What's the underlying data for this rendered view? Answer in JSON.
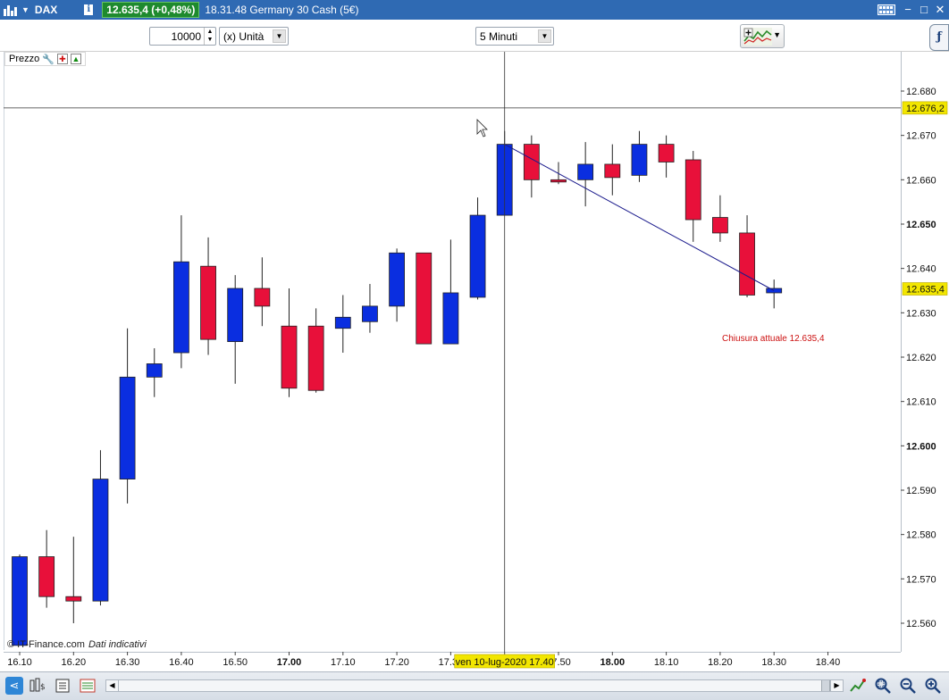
{
  "titlebar": {
    "symbol": "DAX",
    "info": "i",
    "price_badge": "12.635,4 (+0,48%)",
    "description": "18.31.48 Germany 30 Cash (5€)"
  },
  "toolbar": {
    "quantity": "10000",
    "unit": "(x) Unità",
    "timeframe": "5 Minuti"
  },
  "panel": {
    "label": "Prezzo"
  },
  "watermark": {
    "brand": "© IT-Finance.com",
    "note": "Dati indicativi"
  },
  "colors": {
    "up": "#0a2ee0",
    "down": "#e8103a",
    "trendline": "#1a1a8c",
    "badge": "#f2e600",
    "annotation": "#cc1111"
  },
  "chart_data": {
    "type": "candlestick",
    "y_ticks": [
      "12.680",
      "12.670",
      "12.660",
      "12.650",
      "12.640",
      "12.630",
      "12.620",
      "12.610",
      "12.600",
      "12.590",
      "12.580",
      "12.570",
      "12.560"
    ],
    "y_ticks_bold": [
      "12.650",
      "12.600"
    ],
    "ylim": [
      12555,
      12692
    ],
    "x_ticks": [
      {
        "label": "16.10",
        "bold": false
      },
      {
        "label": "16.20",
        "bold": false
      },
      {
        "label": "16.30",
        "bold": false
      },
      {
        "label": "16.40",
        "bold": false
      },
      {
        "label": "16.50",
        "bold": false
      },
      {
        "label": "17.00",
        "bold": true
      },
      {
        "label": "17.10",
        "bold": false
      },
      {
        "label": "17.20",
        "bold": false
      },
      {
        "label": "17.30",
        "bold": false
      },
      {
        "label": "17.40",
        "bold": false
      },
      {
        "label": "17.50",
        "bold": false
      },
      {
        "label": "18.00",
        "bold": true
      },
      {
        "label": "18.10",
        "bold": false
      },
      {
        "label": "18.20",
        "bold": false
      },
      {
        "label": "18.30",
        "bold": false
      },
      {
        "label": "18.40",
        "bold": false
      }
    ],
    "candles": [
      {
        "t": "16.10",
        "o": 12555,
        "h": 12575.5,
        "l": 12555,
        "c": 12575
      },
      {
        "t": "16.15",
        "o": 12575,
        "h": 12581,
        "l": 12563.5,
        "c": 12566
      },
      {
        "t": "16.20",
        "o": 12566,
        "h": 12579.5,
        "l": 12560,
        "c": 12565
      },
      {
        "t": "16.25",
        "o": 12565,
        "h": 12599,
        "l": 12564,
        "c": 12592.5
      },
      {
        "t": "16.30",
        "o": 12592.5,
        "h": 12626.5,
        "l": 12587,
        "c": 12615.5
      },
      {
        "t": "16.35",
        "o": 12615.5,
        "h": 12622,
        "l": 12611,
        "c": 12618.5
      },
      {
        "t": "16.40",
        "o": 12621,
        "h": 12652,
        "l": 12617.5,
        "c": 12641.5
      },
      {
        "t": "16.45",
        "o": 12640.5,
        "h": 12647,
        "l": 12620.5,
        "c": 12624
      },
      {
        "t": "16.50",
        "o": 12623.5,
        "h": 12638.5,
        "l": 12614,
        "c": 12635.5
      },
      {
        "t": "16.55",
        "o": 12635.5,
        "h": 12642.5,
        "l": 12627,
        "c": 12631.5
      },
      {
        "t": "17.00",
        "o": 12627,
        "h": 12635.5,
        "l": 12611,
        "c": 12613
      },
      {
        "t": "17.05",
        "o": 12627,
        "h": 12631,
        "l": 12612,
        "c": 12612.5
      },
      {
        "t": "17.10",
        "o": 12626.5,
        "h": 12634,
        "l": 12621,
        "c": 12629
      },
      {
        "t": "17.15",
        "o": 12628,
        "h": 12636.5,
        "l": 12625.5,
        "c": 12631.5
      },
      {
        "t": "17.20",
        "o": 12631.5,
        "h": 12644.5,
        "l": 12628,
        "c": 12643.5
      },
      {
        "t": "17.25",
        "o": 12643.5,
        "h": 12643.5,
        "l": 12623,
        "c": 12623
      },
      {
        "t": "17.30",
        "o": 12623,
        "h": 12646.5,
        "l": 12623,
        "c": 12634.5
      },
      {
        "t": "17.35",
        "o": 12633.5,
        "h": 12656,
        "l": 12633,
        "c": 12652
      },
      {
        "t": "17.40",
        "o": 12652,
        "h": 12671,
        "l": 12652,
        "c": 12668
      },
      {
        "t": "17.45",
        "o": 12668,
        "h": 12670,
        "l": 12656,
        "c": 12660
      },
      {
        "t": "17.50",
        "o": 12660,
        "h": 12664,
        "l": 12659,
        "c": 12659.5
      },
      {
        "t": "17.55",
        "o": 12660,
        "h": 12668.5,
        "l": 12654,
        "c": 12663.5
      },
      {
        "t": "18.00",
        "o": 12663.5,
        "h": 12668,
        "l": 12656.5,
        "c": 12660.5
      },
      {
        "t": "18.05",
        "o": 12661,
        "h": 12671,
        "l": 12659.5,
        "c": 12668
      },
      {
        "t": "18.10",
        "o": 12668,
        "h": 12670,
        "l": 12660.5,
        "c": 12664
      },
      {
        "t": "18.15",
        "o": 12664.5,
        "h": 12666.5,
        "l": 12646,
        "c": 12651
      },
      {
        "t": "18.20",
        "o": 12651.5,
        "h": 12656.5,
        "l": 12646,
        "c": 12648
      },
      {
        "t": "18.25",
        "o": 12648,
        "h": 12652,
        "l": 12633.5,
        "c": 12634
      },
      {
        "t": "18.30",
        "o": 12634.5,
        "h": 12637.5,
        "l": 12631,
        "c": 12635.5
      }
    ],
    "crosshair": {
      "price": 12676.2,
      "price_label": "12.676,2",
      "time_index": 18,
      "time_label": "ven 10-lug-2020 17.40"
    },
    "last_price": {
      "value": 12635.4,
      "label": "12.635,4"
    },
    "trendline": {
      "from_index": 18,
      "from_price": 12668,
      "to_index": 28,
      "to_price": 12635
    },
    "annotation": "Chiusura attuale 12.635,4"
  }
}
